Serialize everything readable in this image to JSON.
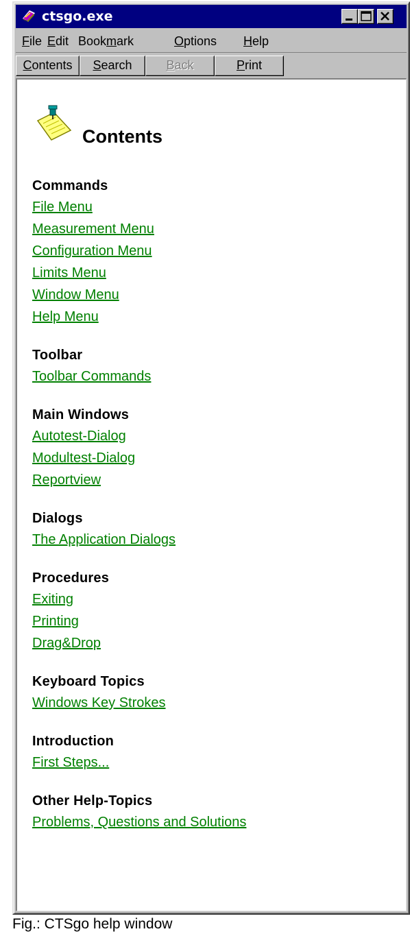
{
  "window": {
    "title": "ctsgo.exe"
  },
  "menubar": {
    "items": [
      {
        "pre": "",
        "u": "F",
        "post": "ile"
      },
      {
        "pre": "",
        "u": "E",
        "post": "dit"
      },
      {
        "pre": "Book",
        "u": "m",
        "post": "ark"
      },
      {
        "pre": "",
        "u": "O",
        "post": "ptions"
      },
      {
        "pre": "",
        "u": "H",
        "post": "elp"
      }
    ]
  },
  "toolbar": {
    "buttons": [
      {
        "pre": "",
        "u": "C",
        "post": "ontents",
        "enabled": true
      },
      {
        "pre": "",
        "u": "S",
        "post": "earch",
        "enabled": true
      },
      {
        "pre": "",
        "u": "B",
        "post": "ack",
        "enabled": false
      },
      {
        "pre": "",
        "u": "P",
        "post": "rint",
        "enabled": true
      }
    ]
  },
  "page": {
    "title": "Contents",
    "sections": [
      {
        "heading": "Commands",
        "links": [
          "File Menu",
          "Measurement Menu",
          "Configuration Menu",
          "Limits Menu",
          "Window Menu",
          "Help Menu"
        ]
      },
      {
        "heading": "Toolbar",
        "links": [
          "Toolbar Commands"
        ]
      },
      {
        "heading": "Main Windows",
        "links": [
          "Autotest-Dialog",
          "Modultest-Dialog",
          "Reportview"
        ]
      },
      {
        "heading": "Dialogs",
        "links": [
          "The Application Dialogs"
        ]
      },
      {
        "heading": "Procedures",
        "links": [
          "Exiting",
          "Printing",
          "Drag&Drop"
        ]
      },
      {
        "heading": "Keyboard Topics",
        "links": [
          "Windows Key Strokes"
        ]
      },
      {
        "heading": "Introduction",
        "links": [
          "First Steps..."
        ]
      },
      {
        "heading": "Other Help-Topics",
        "links": [
          "Problems, Questions and Solutions"
        ]
      }
    ]
  },
  "caption": "Fig.: CTSgo help window",
  "colors": {
    "titlebar": "#000080",
    "link": "#008000",
    "chrome": "#c0c0c0"
  },
  "icons": {
    "app": "help-book-icon",
    "page": "notepad-pushpin-icon",
    "minimize": "minimize-icon",
    "maximize": "maximize-icon",
    "close": "close-icon"
  }
}
